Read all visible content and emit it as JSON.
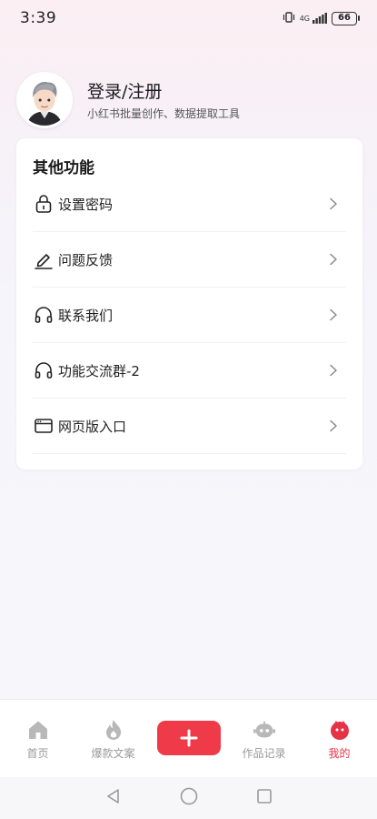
{
  "status_bar": {
    "time": "3:39",
    "network": "4G",
    "battery": "66"
  },
  "profile": {
    "title": "登录/注册",
    "subtitle": "小红书批量创作、数据提取工具"
  },
  "features_card": {
    "title": "其他功能",
    "items": [
      {
        "label": "设置密码",
        "icon": "lock-icon"
      },
      {
        "label": "问题反馈",
        "icon": "edit-icon"
      },
      {
        "label": "联系我们",
        "icon": "headphones-icon"
      },
      {
        "label": "功能交流群-2",
        "icon": "headphones-icon"
      },
      {
        "label": "网页版入口",
        "icon": "browser-window-icon"
      }
    ]
  },
  "tab_bar": {
    "tabs": [
      {
        "label": "首页",
        "icon": "home-icon",
        "active": false
      },
      {
        "label": "爆款文案",
        "icon": "fire-icon",
        "active": false
      },
      {
        "label": "",
        "icon": "plus-icon",
        "active": false
      },
      {
        "label": "作品记录",
        "icon": "robot-icon",
        "active": false
      },
      {
        "label": "我的",
        "icon": "mascot-icon",
        "active": true
      }
    ]
  },
  "colors": {
    "accent": "#ef3a4a",
    "active_tab": "#e53345",
    "inactive_tab": "#9a9a9a"
  }
}
